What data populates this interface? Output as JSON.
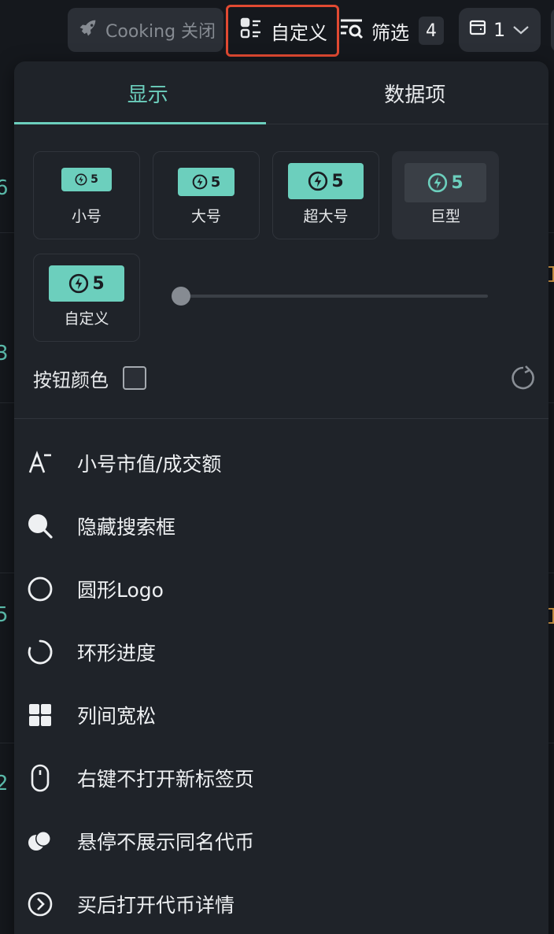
{
  "toolbar": {
    "cooking_label": "Cooking 关闭",
    "custom_label": "自定义",
    "filter_label": "筛选",
    "filter_count": "4",
    "wallet_count": "1"
  },
  "panel": {
    "tabs": [
      {
        "label": "显示",
        "active": true
      },
      {
        "label": "数据项",
        "active": false
      }
    ],
    "button_sizes": [
      {
        "label": "小号",
        "chip_value": "5",
        "selected": false
      },
      {
        "label": "大号",
        "chip_value": "5",
        "selected": false
      },
      {
        "label": "超大号",
        "chip_value": "5",
        "selected": false
      },
      {
        "label": "巨型",
        "chip_value": "5",
        "selected": true
      },
      {
        "label": "自定义",
        "chip_value": "5",
        "selected": false
      }
    ],
    "slider_value": 0,
    "button_color_label": "按钮颜色",
    "menu_items": [
      {
        "label": "小号市值/成交额",
        "icon": "font-size-icon"
      },
      {
        "label": "隐藏搜索框",
        "icon": "search-icon"
      },
      {
        "label": "圆形Logo",
        "icon": "circle-icon"
      },
      {
        "label": "环形进度",
        "icon": "ring-progress-icon"
      },
      {
        "label": "列间宽松",
        "icon": "grid-icon"
      },
      {
        "label": "右键不打开新标签页",
        "icon": "mouse-icon"
      },
      {
        "label": "悬停不展示同名代币",
        "icon": "overlap-circles-icon"
      },
      {
        "label": "买后打开代币详情",
        "icon": "chevron-circle-icon"
      }
    ]
  },
  "colors": {
    "accent": "#6ccfbd",
    "panel_bg": "#1f2329",
    "highlight_border": "#e24a32"
  }
}
